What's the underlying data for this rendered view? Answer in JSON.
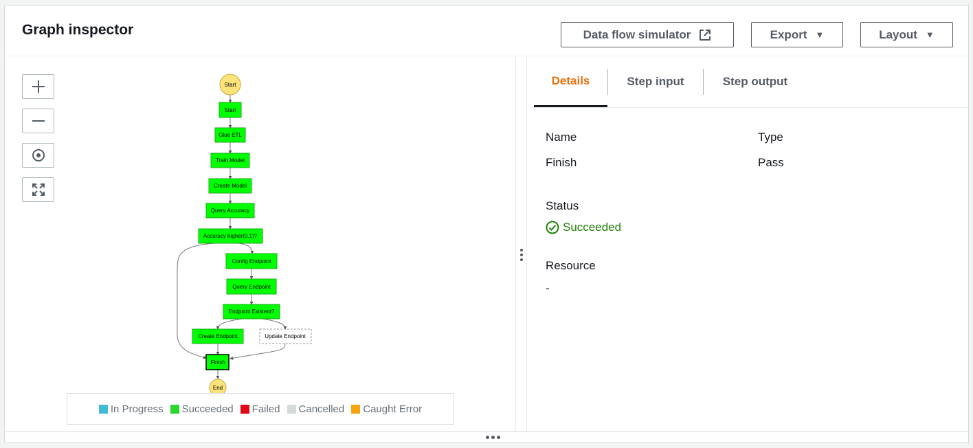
{
  "header": {
    "title": "Graph inspector",
    "buttons": {
      "simulator": "Data flow simulator",
      "export": "Export",
      "layout": "Layout"
    }
  },
  "zoom_controls": [
    "zoom-in-icon",
    "zoom-out-icon",
    "center-icon",
    "fit-icon"
  ],
  "graph": {
    "nodes": [
      {
        "id": "start-circle",
        "label": "Start",
        "kind": "terminal"
      },
      {
        "id": "start",
        "label": "Start",
        "kind": "state",
        "status": "Succeeded"
      },
      {
        "id": "glue-etl",
        "label": "Glue ETL",
        "kind": "state",
        "status": "Succeeded"
      },
      {
        "id": "train-model",
        "label": "Train Model",
        "kind": "state",
        "status": "Succeeded"
      },
      {
        "id": "create-model",
        "label": "Create Model",
        "kind": "state",
        "status": "Succeeded"
      },
      {
        "id": "query-accuracy",
        "label": "Query Accuracy",
        "kind": "state",
        "status": "Succeeded"
      },
      {
        "id": "accuracy-higher",
        "label": "Accuracy higher(0.1)?",
        "kind": "state",
        "status": "Succeeded"
      },
      {
        "id": "config-endpoint",
        "label": "Config Endpoint",
        "kind": "state",
        "status": "Succeeded"
      },
      {
        "id": "query-endpoint",
        "label": "Query Endpoint",
        "kind": "state",
        "status": "Succeeded"
      },
      {
        "id": "endpoint-existent",
        "label": "Endpoint Existent?",
        "kind": "state",
        "status": "Succeeded"
      },
      {
        "id": "create-endpoint",
        "label": "Create Endpoint",
        "kind": "state",
        "status": "Succeeded"
      },
      {
        "id": "update-endpoint",
        "label": "Update Endpoint",
        "kind": "state",
        "status": "NotRun"
      },
      {
        "id": "finish",
        "label": "Finish",
        "kind": "state",
        "status": "Succeeded",
        "selected": true
      },
      {
        "id": "end-circle",
        "label": "End",
        "kind": "terminal"
      }
    ],
    "legend": [
      {
        "label": "In Progress",
        "color": "#44b9d6"
      },
      {
        "label": "Succeeded",
        "color": "#2bd62e"
      },
      {
        "label": "Failed",
        "color": "#de0a19"
      },
      {
        "label": "Cancelled",
        "color": "#d5dbdb"
      },
      {
        "label": "Caught Error",
        "color": "#f7a410"
      }
    ],
    "colors": {
      "succeeded": "#00ff00",
      "terminal": "#fce37a"
    }
  },
  "details": {
    "tabs": [
      "Details",
      "Step input",
      "Step output"
    ],
    "active_tab": "Details",
    "name_label": "Name",
    "name_value": "Finish",
    "type_label": "Type",
    "type_value": "Pass",
    "status_label": "Status",
    "status_value": "Succeeded",
    "resource_label": "Resource",
    "resource_value": "-"
  }
}
